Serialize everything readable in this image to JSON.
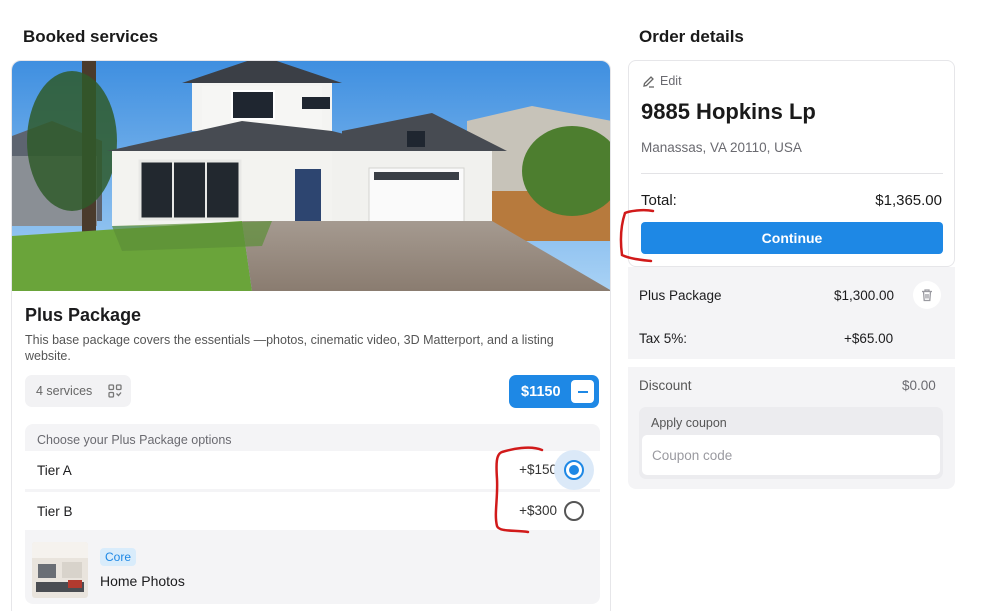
{
  "booked": {
    "section_title": "Booked services",
    "package_title": "Plus Package",
    "package_description": "This base package covers the essentials —photos, cinematic video, 3D Matterport, and a listing website.",
    "services_count": "4 services",
    "price": "$1150",
    "options_label": "Choose your Plus Package options",
    "tiers": [
      {
        "name": "Tier A",
        "price": "+$150",
        "selected": true
      },
      {
        "name": "Tier B",
        "price": "+$300",
        "selected": false
      }
    ],
    "service": {
      "badge": "Core",
      "name": "Home Photos"
    }
  },
  "order": {
    "section_title": "Order details",
    "edit_label": "Edit",
    "address_line1": "9885 Hopkins Lp",
    "address_line2": "Manassas, VA 20110, USA",
    "total_label": "Total:",
    "total_value": "$1,365.00",
    "continue_label": "Continue",
    "summary": {
      "package_label": "Plus Package",
      "package_value": "$1,300.00",
      "tax_label": "Tax 5%:",
      "tax_value": "+$65.00",
      "discount_label": "Discount",
      "discount_value": "$0.00",
      "coupon_label": "Apply coupon",
      "coupon_placeholder": "Coupon code"
    }
  },
  "colors": {
    "accent": "#1e88e5",
    "annotation": "#d11a1a"
  },
  "icons": [
    "grid-icon",
    "minus-icon",
    "pencil-icon",
    "trash-icon"
  ]
}
